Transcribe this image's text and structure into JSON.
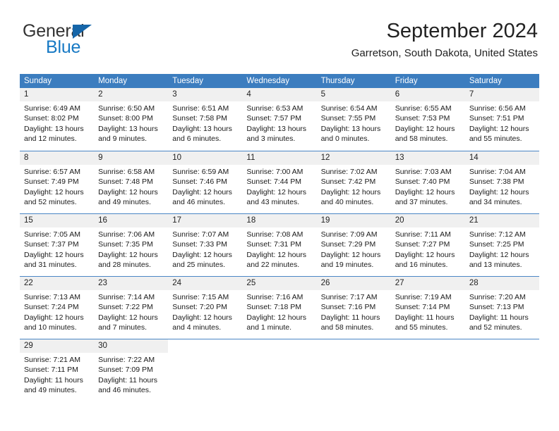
{
  "brand": {
    "word_general": "General",
    "word_blue": "Blue",
    "accent_blue": "#1779c4",
    "header_blue": "#3c7dbf",
    "daynum_band": "#f0f0f0"
  },
  "header": {
    "title": "September 2024",
    "subtitle": "Garretson, South Dakota, United States"
  },
  "calendar": {
    "weekdays": [
      "Sunday",
      "Monday",
      "Tuesday",
      "Wednesday",
      "Thursday",
      "Friday",
      "Saturday"
    ],
    "weeks": [
      [
        {
          "day": "1",
          "sunrise": "Sunrise: 6:49 AM",
          "sunset": "Sunset: 8:02 PM",
          "daylight1": "Daylight: 13 hours",
          "daylight2": "and 12 minutes."
        },
        {
          "day": "2",
          "sunrise": "Sunrise: 6:50 AM",
          "sunset": "Sunset: 8:00 PM",
          "daylight1": "Daylight: 13 hours",
          "daylight2": "and 9 minutes."
        },
        {
          "day": "3",
          "sunrise": "Sunrise: 6:51 AM",
          "sunset": "Sunset: 7:58 PM",
          "daylight1": "Daylight: 13 hours",
          "daylight2": "and 6 minutes."
        },
        {
          "day": "4",
          "sunrise": "Sunrise: 6:53 AM",
          "sunset": "Sunset: 7:57 PM",
          "daylight1": "Daylight: 13 hours",
          "daylight2": "and 3 minutes."
        },
        {
          "day": "5",
          "sunrise": "Sunrise: 6:54 AM",
          "sunset": "Sunset: 7:55 PM",
          "daylight1": "Daylight: 13 hours",
          "daylight2": "and 0 minutes."
        },
        {
          "day": "6",
          "sunrise": "Sunrise: 6:55 AM",
          "sunset": "Sunset: 7:53 PM",
          "daylight1": "Daylight: 12 hours",
          "daylight2": "and 58 minutes."
        },
        {
          "day": "7",
          "sunrise": "Sunrise: 6:56 AM",
          "sunset": "Sunset: 7:51 PM",
          "daylight1": "Daylight: 12 hours",
          "daylight2": "and 55 minutes."
        }
      ],
      [
        {
          "day": "8",
          "sunrise": "Sunrise: 6:57 AM",
          "sunset": "Sunset: 7:49 PM",
          "daylight1": "Daylight: 12 hours",
          "daylight2": "and 52 minutes."
        },
        {
          "day": "9",
          "sunrise": "Sunrise: 6:58 AM",
          "sunset": "Sunset: 7:48 PM",
          "daylight1": "Daylight: 12 hours",
          "daylight2": "and 49 minutes."
        },
        {
          "day": "10",
          "sunrise": "Sunrise: 6:59 AM",
          "sunset": "Sunset: 7:46 PM",
          "daylight1": "Daylight: 12 hours",
          "daylight2": "and 46 minutes."
        },
        {
          "day": "11",
          "sunrise": "Sunrise: 7:00 AM",
          "sunset": "Sunset: 7:44 PM",
          "daylight1": "Daylight: 12 hours",
          "daylight2": "and 43 minutes."
        },
        {
          "day": "12",
          "sunrise": "Sunrise: 7:02 AM",
          "sunset": "Sunset: 7:42 PM",
          "daylight1": "Daylight: 12 hours",
          "daylight2": "and 40 minutes."
        },
        {
          "day": "13",
          "sunrise": "Sunrise: 7:03 AM",
          "sunset": "Sunset: 7:40 PM",
          "daylight1": "Daylight: 12 hours",
          "daylight2": "and 37 minutes."
        },
        {
          "day": "14",
          "sunrise": "Sunrise: 7:04 AM",
          "sunset": "Sunset: 7:38 PM",
          "daylight1": "Daylight: 12 hours",
          "daylight2": "and 34 minutes."
        }
      ],
      [
        {
          "day": "15",
          "sunrise": "Sunrise: 7:05 AM",
          "sunset": "Sunset: 7:37 PM",
          "daylight1": "Daylight: 12 hours",
          "daylight2": "and 31 minutes."
        },
        {
          "day": "16",
          "sunrise": "Sunrise: 7:06 AM",
          "sunset": "Sunset: 7:35 PM",
          "daylight1": "Daylight: 12 hours",
          "daylight2": "and 28 minutes."
        },
        {
          "day": "17",
          "sunrise": "Sunrise: 7:07 AM",
          "sunset": "Sunset: 7:33 PM",
          "daylight1": "Daylight: 12 hours",
          "daylight2": "and 25 minutes."
        },
        {
          "day": "18",
          "sunrise": "Sunrise: 7:08 AM",
          "sunset": "Sunset: 7:31 PM",
          "daylight1": "Daylight: 12 hours",
          "daylight2": "and 22 minutes."
        },
        {
          "day": "19",
          "sunrise": "Sunrise: 7:09 AM",
          "sunset": "Sunset: 7:29 PM",
          "daylight1": "Daylight: 12 hours",
          "daylight2": "and 19 minutes."
        },
        {
          "day": "20",
          "sunrise": "Sunrise: 7:11 AM",
          "sunset": "Sunset: 7:27 PM",
          "daylight1": "Daylight: 12 hours",
          "daylight2": "and 16 minutes."
        },
        {
          "day": "21",
          "sunrise": "Sunrise: 7:12 AM",
          "sunset": "Sunset: 7:25 PM",
          "daylight1": "Daylight: 12 hours",
          "daylight2": "and 13 minutes."
        }
      ],
      [
        {
          "day": "22",
          "sunrise": "Sunrise: 7:13 AM",
          "sunset": "Sunset: 7:24 PM",
          "daylight1": "Daylight: 12 hours",
          "daylight2": "and 10 minutes."
        },
        {
          "day": "23",
          "sunrise": "Sunrise: 7:14 AM",
          "sunset": "Sunset: 7:22 PM",
          "daylight1": "Daylight: 12 hours",
          "daylight2": "and 7 minutes."
        },
        {
          "day": "24",
          "sunrise": "Sunrise: 7:15 AM",
          "sunset": "Sunset: 7:20 PM",
          "daylight1": "Daylight: 12 hours",
          "daylight2": "and 4 minutes."
        },
        {
          "day": "25",
          "sunrise": "Sunrise: 7:16 AM",
          "sunset": "Sunset: 7:18 PM",
          "daylight1": "Daylight: 12 hours",
          "daylight2": "and 1 minute."
        },
        {
          "day": "26",
          "sunrise": "Sunrise: 7:17 AM",
          "sunset": "Sunset: 7:16 PM",
          "daylight1": "Daylight: 11 hours",
          "daylight2": "and 58 minutes."
        },
        {
          "day": "27",
          "sunrise": "Sunrise: 7:19 AM",
          "sunset": "Sunset: 7:14 PM",
          "daylight1": "Daylight: 11 hours",
          "daylight2": "and 55 minutes."
        },
        {
          "day": "28",
          "sunrise": "Sunrise: 7:20 AM",
          "sunset": "Sunset: 7:13 PM",
          "daylight1": "Daylight: 11 hours",
          "daylight2": "and 52 minutes."
        }
      ],
      [
        {
          "day": "29",
          "sunrise": "Sunrise: 7:21 AM",
          "sunset": "Sunset: 7:11 PM",
          "daylight1": "Daylight: 11 hours",
          "daylight2": "and 49 minutes."
        },
        {
          "day": "30",
          "sunrise": "Sunrise: 7:22 AM",
          "sunset": "Sunset: 7:09 PM",
          "daylight1": "Daylight: 11 hours",
          "daylight2": "and 46 minutes."
        },
        {
          "day": "",
          "sunrise": "",
          "sunset": "",
          "daylight1": "",
          "daylight2": ""
        },
        {
          "day": "",
          "sunrise": "",
          "sunset": "",
          "daylight1": "",
          "daylight2": ""
        },
        {
          "day": "",
          "sunrise": "",
          "sunset": "",
          "daylight1": "",
          "daylight2": ""
        },
        {
          "day": "",
          "sunrise": "",
          "sunset": "",
          "daylight1": "",
          "daylight2": ""
        },
        {
          "day": "",
          "sunrise": "",
          "sunset": "",
          "daylight1": "",
          "daylight2": ""
        }
      ]
    ]
  }
}
